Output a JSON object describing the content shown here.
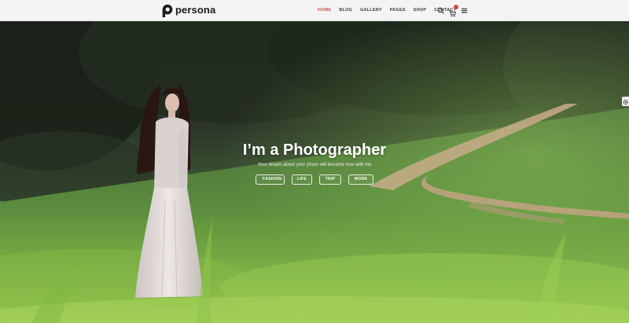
{
  "header": {
    "logo_text": "persona",
    "logo_icon": "p-letter-logo",
    "nav": [
      {
        "label": "HOME",
        "active": true
      },
      {
        "label": "BLOG"
      },
      {
        "label": "GALLERY"
      },
      {
        "label": "PAGES"
      },
      {
        "label": "SHOP"
      },
      {
        "label": "CONTACT"
      }
    ],
    "icons": [
      "search-icon",
      "cart-icon",
      "menu-icon"
    ]
  },
  "hero": {
    "title": "I’m a Photographer",
    "subtitle": "Your dream about your photo will become true with me",
    "tags": [
      "FASHION",
      "LIFE",
      "TRIP",
      "WORK"
    ]
  },
  "side_widget": {
    "icon": "settings-gear-icon"
  },
  "colors": {
    "accent": "#d0463b",
    "header_bg": "#f4f4f4",
    "logo": "#1c1c1c",
    "nav_text": "#3a3a3a",
    "hero_text": "#ffffff"
  }
}
